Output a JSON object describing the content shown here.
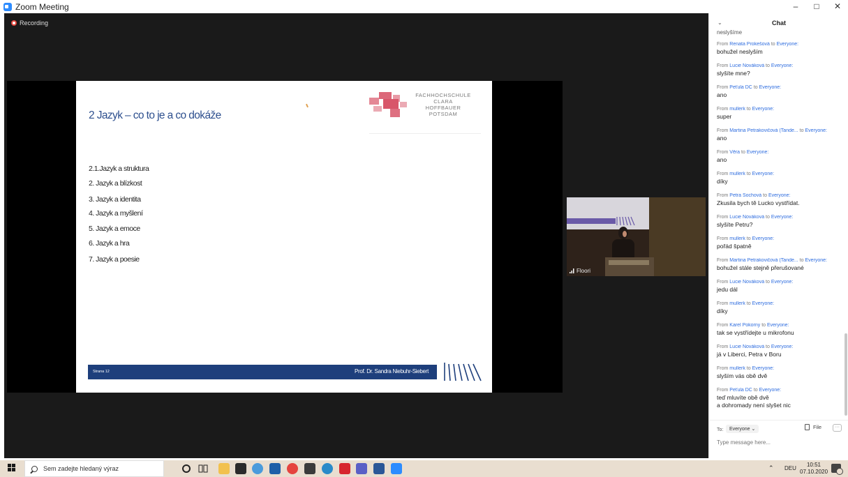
{
  "window": {
    "title": "Zoom Meeting",
    "controls": {
      "minimize": "–",
      "maximize": "□",
      "close": "✕"
    }
  },
  "meeting": {
    "recording_label": "Recording",
    "participant_name": "Floori"
  },
  "slide": {
    "title": "2 Jazyk – co to je a co dokáže",
    "logo_lines": [
      "FACHHOCHSCHULE",
      "CLARA HOFFBAUER",
      "POTSDAM"
    ],
    "items": [
      "2.1.Jazyk a struktura",
      "2.  Jazyk a blízkost",
      "3.  Jazyk a identita",
      "4.  Jazyk a myšlení",
      "5.  Jazyk a emoce",
      "6.  Jazyk a hra",
      "7.  Jazyk a poesie"
    ],
    "footer_page": "Strana 12",
    "footer_author": "Prof. Dr. Sandra Niebuhr-Siebert"
  },
  "chat": {
    "title": "Chat",
    "collapse_icon": "chevron-down",
    "partial_top_text": "neslyšíme",
    "messages": [
      {
        "from": "Renata Prokešová",
        "to": "Everyone",
        "text": "bohužel neslyším"
      },
      {
        "from": "Lucie Nováková",
        "to": "Everyone",
        "text": "slyšíte mne?"
      },
      {
        "from": "Peťula DC",
        "to": "Everyone",
        "text": "ano"
      },
      {
        "from": "mullerk",
        "to": "Everyone",
        "text": "super"
      },
      {
        "from": "Martina Petrakovičová (Tande...",
        "to": "Everyone",
        "text": "ano"
      },
      {
        "from": "Věra",
        "to": "Everyone",
        "text": "ano"
      },
      {
        "from": "mullerk",
        "to": "Everyone",
        "text": "díky"
      },
      {
        "from": "Petra Sochová",
        "to": "Everyone",
        "text": "Zkusila bych tě Lucko vystřídat."
      },
      {
        "from": "Lucie Nováková",
        "to": "Everyone",
        "text": "slyšíte Petru?"
      },
      {
        "from": "mullerk",
        "to": "Everyone",
        "text": "pořád špatně"
      },
      {
        "from": "Martina Petrakovičová (Tande...",
        "to": "Everyone",
        "text": "bohužel stále stejně přerušované"
      },
      {
        "from": "Lucie Nováková",
        "to": "Everyone",
        "text": "jedu dál"
      },
      {
        "from": "mullerk",
        "to": "Everyone",
        "text": "díky"
      },
      {
        "from": "Karel Pokorny",
        "to": "Everyone",
        "text": "tak se vystřídejte u mikrofonu"
      },
      {
        "from": "Lucie Nováková",
        "to": "Everyone",
        "text": "já v Liberci, Petra v Boru"
      },
      {
        "from": "mullerk",
        "to": "Everyone",
        "text": "slyším vás obě dvě"
      },
      {
        "from": "Peťula DC",
        "to": "Everyone",
        "text": "teď mluvíte obě dvě\na dohromady není slyšet nic"
      }
    ],
    "from_word": "From",
    "to_word": "to",
    "to_label": "To:",
    "to_value": "Everyone ⌄",
    "file_label": "File",
    "more_label": "···",
    "input_placeholder": "Type message here..."
  },
  "taskbar": {
    "search_placeholder": "Sem zadejte hledaný výraz",
    "language": "DEU",
    "time": "10:51",
    "date": "07.10.2020",
    "tray_chevron": "⌃",
    "icons": [
      "cortana-icon",
      "task-view-icon",
      "file-explorer-icon",
      "store-icon",
      "chrome-icon",
      "mail-icon",
      "opera-icon",
      "calculator-icon",
      "edge-icon",
      "acrobat-icon",
      "teams-icon",
      "word-icon",
      "zoom-icon"
    ]
  }
}
